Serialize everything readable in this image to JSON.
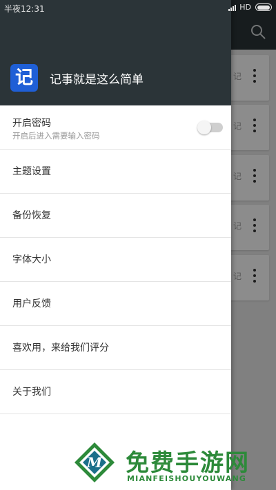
{
  "status_bar": {
    "time": "半夜12:31",
    "network": "HD"
  },
  "drawer": {
    "app_icon_text": "记",
    "slogan": "记事就是这么简单",
    "items": [
      {
        "label": "开启密码",
        "sublabel": "开启后进入需要输入密码",
        "toggle": false
      },
      {
        "label": "主题设置"
      },
      {
        "label": "备份恢复"
      },
      {
        "label": "字体大小"
      },
      {
        "label": "用户反馈"
      },
      {
        "label": "喜欢用，来给我们评分"
      },
      {
        "label": "关于我们"
      }
    ]
  },
  "background": {
    "cards": [
      {
        "text": "记"
      },
      {
        "text": "记"
      },
      {
        "text": "记"
      },
      {
        "text": "记"
      },
      {
        "text": "记"
      }
    ]
  },
  "watermark": {
    "title": "免费手游网",
    "subtitle": "MIANFEISHOUYOUWANG"
  },
  "colors": {
    "toolbar": "#2b3438",
    "app_icon": "#1f5fd6",
    "watermark": "#2d8a3a"
  }
}
